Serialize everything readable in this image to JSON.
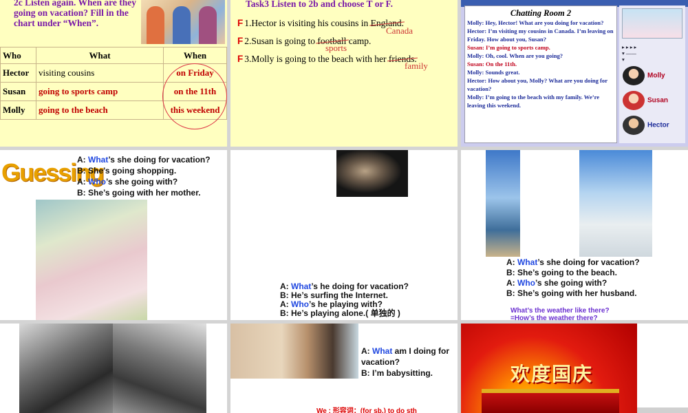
{
  "slide1": {
    "title": "2c Listen again. When are they going on vacation? Fill in the chart under “When”.",
    "headers": [
      "Who",
      "What",
      "When"
    ],
    "rows": [
      {
        "who": "Hector",
        "what": "visiting cousins",
        "when": "on Friday"
      },
      {
        "who": "Susan",
        "what": "going to sports camp",
        "when": "on the 11th"
      },
      {
        "who": "Molly",
        "what": "going to the beach",
        "when": "this weekend"
      }
    ]
  },
  "slide2": {
    "task": "Task3 Listen to 2b and choose T or F.",
    "mark": "F",
    "items": [
      {
        "pre": "1.Hector is visiting his cousins in ",
        "struck": "England",
        "post": ".",
        "correction": "Canada"
      },
      {
        "pre": "2.Susan is going to ",
        "struck": "football",
        "post": " camp.",
        "correction": "sports"
      },
      {
        "pre": "3.Molly is going to the beach with her ",
        "struck": "friends",
        "post": ".",
        "correction": "family"
      }
    ]
  },
  "slide3": {
    "title": "Chatting Room 2",
    "lines": [
      {
        "speaker": "Molly:",
        "text": "Hey, Hector! What are you doing for vacation?",
        "color": "blue"
      },
      {
        "speaker": "Hector:",
        "text": "I’m visiting my cousins in Canada. I’m leaving on Friday. How about you, Susan?",
        "color": "blue"
      },
      {
        "speaker": "Susan:",
        "text": "I’m going to sports camp.",
        "color": "red"
      },
      {
        "speaker": "Molly:",
        "text": "Oh, cool. When are you going?",
        "color": "blue"
      },
      {
        "speaker": "Susan:",
        "text": "On the 11th.",
        "color": "red"
      },
      {
        "speaker": "Molly:",
        "text": "Sounds great.",
        "color": "blue"
      },
      {
        "speaker": "Hector:",
        "text": "How about you, Molly? What are you doing for vacation?",
        "color": "blue"
      },
      {
        "speaker": "Molly:",
        "text": "I’m going to the beach with my family. We’re leaving this weekend.",
        "color": "blue"
      }
    ],
    "buddies": [
      "Molly",
      "Susan",
      "Hector"
    ]
  },
  "slide4": {
    "heading": "Guessing",
    "dialog": [
      {
        "wh": "What",
        "rest": "’s she doing for vacation?",
        "prefix": "A: "
      },
      {
        "wh": "",
        "rest": "B: She’s going shopping.",
        "prefix": ""
      },
      {
        "wh": "Who",
        "rest": "’s she going with?",
        "prefix": "A: "
      },
      {
        "wh": "",
        "rest": "B: She’s going with her mother.",
        "prefix": ""
      }
    ]
  },
  "slide5": {
    "dialog": [
      {
        "prefix": "A: ",
        "wh": "What",
        "rest": "’s he doing for vacation?"
      },
      {
        "prefix": "",
        "wh": "",
        "rest": "B: He’s surfing the Internet."
      },
      {
        "prefix": "A: ",
        "wh": "Who",
        "rest": "’s he playing with?"
      },
      {
        "prefix": "",
        "wh": "",
        "rest": "B: He’s playing alone.( 单独的 )"
      }
    ]
  },
  "slide6": {
    "dialog": [
      {
        "prefix": "A: ",
        "wh": "What",
        "rest": "’s she doing for vacation?"
      },
      {
        "prefix": "",
        "wh": "",
        "rest": "B: She’s going to the beach."
      },
      {
        "prefix": "A: ",
        "wh": "Who",
        "rest": "’s she going with?"
      },
      {
        "prefix": "",
        "wh": "",
        "rest": "B: She’s going with her husband."
      }
    ],
    "q1": "What’s the weather like there?",
    "q2": "=How’s the weather there?"
  },
  "slide8": {
    "dialog": [
      {
        "prefix": "A: ",
        "wh": "What",
        "rest": " am I doing for vacation?"
      },
      {
        "prefix": "",
        "wh": "",
        "rest": "B: I’m babysitting."
      }
    ],
    "footer": "We : 形容词：(for sb.) to do sth"
  },
  "slide9": {
    "title": "欢度国庆"
  }
}
